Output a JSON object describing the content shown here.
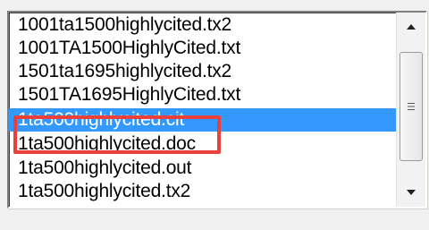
{
  "listbox": {
    "items": [
      {
        "label": "1001ta1500highlycited.tx2"
      },
      {
        "label": "1001TA1500HighlyCited.txt"
      },
      {
        "label": "1501ta1695highlycited.tx2"
      },
      {
        "label": "1501TA1695HighlyCited.txt"
      },
      {
        "label": "1ta500highlycited.cit",
        "selected": true
      },
      {
        "label": "1ta500highlycited.doc"
      },
      {
        "label": "1ta500highlycited.out"
      },
      {
        "label": "1ta500highlycited.tx2"
      }
    ],
    "selected_index": 4
  },
  "scrollbar": {
    "up_icon": "scroll-up-arrow-icon",
    "down_icon": "scroll-down-arrow-icon",
    "thumb_grip_icon": "grip-icon"
  },
  "colors": {
    "selection": "#3399ff",
    "highlight_annotation": "#e8403a"
  }
}
